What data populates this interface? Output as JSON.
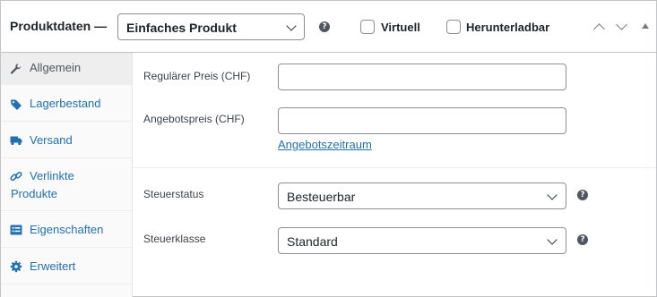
{
  "header": {
    "title": "Produktdaten —",
    "product_type": {
      "selected": "Einfaches Produkt"
    },
    "help_symbol": "?",
    "virtual_label": "Virtuell",
    "virtual_checked": false,
    "downloadable_label": "Herunterladbar",
    "downloadable_checked": false,
    "icons": [
      "help-icon",
      "move-up-icon",
      "move-down-icon",
      "toggle-panel-icon"
    ]
  },
  "sidebar": {
    "items": [
      {
        "label": "Allgemein",
        "icon": "wrench-icon",
        "active": true
      },
      {
        "label": "Lagerbestand",
        "icon": "tag-icon",
        "active": false
      },
      {
        "label": "Versand",
        "icon": "truck-icon",
        "active": false
      },
      {
        "label": "Verlinkte",
        "label_line2": "Produkte",
        "icon": "link-icon",
        "active": false
      },
      {
        "label": "Eigenschaften",
        "icon": "list-icon",
        "active": false
      },
      {
        "label": "Erweitert",
        "icon": "gear-icon",
        "active": false
      }
    ]
  },
  "general": {
    "regular_price": {
      "label": "Regulärer Preis (CHF)",
      "value": ""
    },
    "sale_price": {
      "label": "Angebotspreis (CHF)",
      "value": "",
      "schedule_link": "Angebotszeitraum"
    },
    "tax_status": {
      "label": "Steuerstatus",
      "selected": "Besteuerbar"
    },
    "tax_class": {
      "label": "Steuerklasse",
      "selected": "Standard"
    }
  },
  "colors": {
    "link": "#2271b1",
    "border": "#c3c4c7",
    "sidebar_bg": "#fafafa",
    "active_tab_bg": "#eeeeee"
  }
}
